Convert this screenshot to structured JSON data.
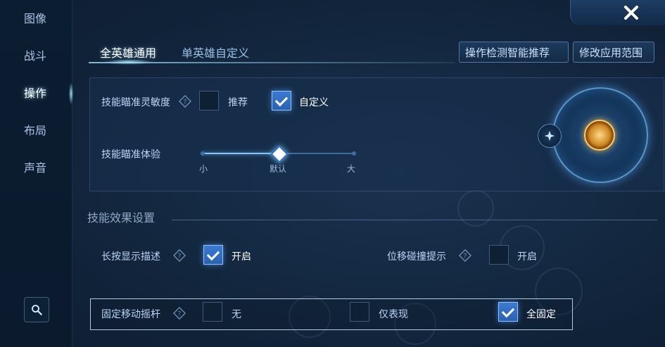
{
  "sidebar": {
    "items": [
      {
        "label": "图像"
      },
      {
        "label": "战斗"
      },
      {
        "label": "操作"
      },
      {
        "label": "布局"
      },
      {
        "label": "声音"
      }
    ],
    "active": "操作"
  },
  "tabs": [
    {
      "label": "全英雄通用",
      "active": true
    },
    {
      "label": "单英雄自定义",
      "active": false
    }
  ],
  "top_buttons": {
    "detect_recommend": "操作检测智能推荐",
    "modify_scope": "修改应用范围"
  },
  "aim": {
    "sensitivity_label": "技能瞄准灵敏度",
    "recommend_label": "推荐",
    "custom_label": "自定义",
    "experience_label": "技能瞄准体验",
    "ticks": [
      "小",
      "默认",
      "大"
    ],
    "experience_level": "默认"
  },
  "effects": {
    "section_title": "技能效果设置",
    "long_press_label": "长按显示描述",
    "on_label": "开启",
    "displacement_label": "位移碰撞提示",
    "off_label": "开启"
  },
  "fixed_joystick": {
    "label": "固定移动摇杆",
    "options": [
      "无",
      "仅表现",
      "全固定"
    ],
    "selected": "全固定"
  },
  "icons": {
    "close": "close-icon",
    "search": "search-icon",
    "help": "question-diamond-icon"
  },
  "colors": {
    "accent": "#3b7bd1",
    "panel": "#18304e",
    "text": "#cfe1ff"
  }
}
